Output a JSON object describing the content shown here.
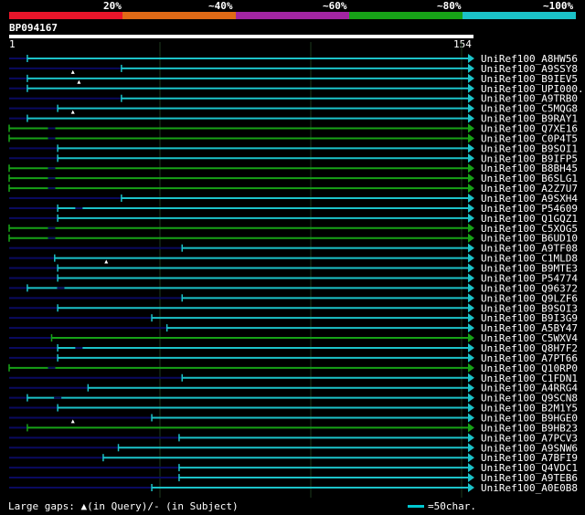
{
  "legend": {
    "labels": [
      "20%",
      "~40%",
      "~60%",
      "~80%",
      "~100%"
    ],
    "colors": [
      "#e8152a",
      "#e06a16",
      "#a225a2",
      "#17a217",
      "#1bc2c8"
    ]
  },
  "query": {
    "id": "BP094167",
    "length_start": "1",
    "length_end": "154"
  },
  "hits": [
    {
      "label": "UniRef100_A8HW56",
      "start": 7,
      "color": "cyan",
      "gaps": []
    },
    {
      "label": "UniRef100_A9SSY8",
      "start": 38,
      "color": "cyan",
      "gaps": []
    },
    {
      "label": "UniRef100_B9IEV5",
      "start": 7,
      "color": "cyan",
      "gaps": [
        {
          "type": "query",
          "pos": 22
        }
      ]
    },
    {
      "label": "UniRef100_UPI000...",
      "start": 7,
      "color": "cyan",
      "gaps": [
        {
          "type": "query",
          "pos": 24
        }
      ]
    },
    {
      "label": "UniRef100_A9TRB0",
      "start": 38,
      "color": "cyan",
      "gaps": []
    },
    {
      "label": "UniRef100_C5MQG8",
      "start": 17,
      "color": "cyan",
      "gaps": []
    },
    {
      "label": "UniRef100_B9RAY1",
      "start": 7,
      "color": "cyan",
      "gaps": [
        {
          "type": "query",
          "pos": 22
        }
      ]
    },
    {
      "label": "UniRef100_Q7XE16",
      "start": 1,
      "color": "green",
      "gaps": [
        {
          "type": "subject",
          "pos": 15
        }
      ]
    },
    {
      "label": "UniRef100_C0P4T5",
      "start": 1,
      "color": "green",
      "gaps": [
        {
          "type": "subject",
          "pos": 15
        }
      ]
    },
    {
      "label": "UniRef100_B9SOI1",
      "start": 17,
      "color": "cyan",
      "gaps": []
    },
    {
      "label": "UniRef100_B9IFP5",
      "start": 17,
      "color": "cyan",
      "gaps": []
    },
    {
      "label": "UniRef100_B8BH45",
      "start": 1,
      "color": "green",
      "gaps": [
        {
          "type": "subject",
          "pos": 15
        }
      ]
    },
    {
      "label": "UniRef100_B6SLG1",
      "start": 1,
      "color": "green",
      "gaps": [
        {
          "type": "subject",
          "pos": 15
        }
      ]
    },
    {
      "label": "UniRef100_A2Z7U7",
      "start": 1,
      "color": "green",
      "gaps": [
        {
          "type": "subject",
          "pos": 15
        }
      ]
    },
    {
      "label": "UniRef100_A9SXH4",
      "start": 38,
      "color": "cyan",
      "gaps": []
    },
    {
      "label": "UniRef100_P54609",
      "start": 17,
      "color": "cyan",
      "gaps": [
        {
          "type": "subject",
          "pos": 24
        }
      ]
    },
    {
      "label": "UniRef100_Q1GQZ1",
      "start": 17,
      "color": "cyan",
      "gaps": []
    },
    {
      "label": "UniRef100_C5XOG5",
      "start": 1,
      "color": "green",
      "gaps": [
        {
          "type": "subject",
          "pos": 15
        }
      ]
    },
    {
      "label": "UniRef100_B6UD10",
      "start": 1,
      "color": "green",
      "gaps": [
        {
          "type": "subject",
          "pos": 15
        }
      ]
    },
    {
      "label": "UniRef100_A9TF08",
      "start": 58,
      "color": "cyan",
      "gaps": []
    },
    {
      "label": "UniRef100_C1MLD8",
      "start": 16,
      "color": "cyan",
      "gaps": []
    },
    {
      "label": "UniRef100_B9MTE3",
      "start": 17,
      "color": "cyan",
      "gaps": [
        {
          "type": "query",
          "pos": 33
        }
      ]
    },
    {
      "label": "UniRef100_P54774",
      "start": 17,
      "color": "cyan",
      "gaps": []
    },
    {
      "label": "UniRef100_Q96372",
      "start": 7,
      "color": "cyan",
      "gaps": [
        {
          "type": "subject",
          "pos": 18
        }
      ]
    },
    {
      "label": "UniRef100_Q9LZF6",
      "start": 58,
      "color": "cyan",
      "gaps": []
    },
    {
      "label": "UniRef100_B9SOI3",
      "start": 17,
      "color": "cyan",
      "gaps": []
    },
    {
      "label": "UniRef100_B9I3G9",
      "start": 48,
      "color": "cyan",
      "gaps": []
    },
    {
      "label": "UniRef100_A5BY47",
      "start": 53,
      "color": "cyan",
      "gaps": []
    },
    {
      "label": "UniRef100_C5WXV4",
      "start": 15,
      "color": "green",
      "gaps": []
    },
    {
      "label": "UniRef100_Q8H7F2",
      "start": 17,
      "color": "cyan",
      "gaps": [
        {
          "type": "subject",
          "pos": 24
        }
      ]
    },
    {
      "label": "UniRef100_A7PT66",
      "start": 17,
      "color": "cyan",
      "gaps": []
    },
    {
      "label": "UniRef100_Q10RP0",
      "start": 1,
      "color": "green",
      "gaps": [
        {
          "type": "subject",
          "pos": 15
        }
      ]
    },
    {
      "label": "UniRef100_C1FDN1",
      "start": 58,
      "color": "cyan",
      "gaps": []
    },
    {
      "label": "UniRef100_A4RRG4",
      "start": 27,
      "color": "cyan",
      "gaps": []
    },
    {
      "label": "UniRef100_Q9SCN8",
      "start": 7,
      "color": "cyan",
      "gaps": [
        {
          "type": "subject",
          "pos": 17
        }
      ]
    },
    {
      "label": "UniRef100_B2M1Y5",
      "start": 17,
      "color": "cyan",
      "gaps": []
    },
    {
      "label": "UniRef100_B9HGE0",
      "start": 48,
      "color": "cyan",
      "gaps": []
    },
    {
      "label": "UniRef100_B9HB23",
      "start": 7,
      "color": "green",
      "gaps": [
        {
          "type": "query",
          "pos": 22
        }
      ]
    },
    {
      "label": "UniRef100_A7PCV3",
      "start": 57,
      "color": "cyan",
      "gaps": []
    },
    {
      "label": "UniRef100_A9SNW6",
      "start": 37,
      "color": "cyan",
      "gaps": []
    },
    {
      "label": "UniRef100_A7BFI9",
      "start": 32,
      "color": "cyan",
      "gaps": []
    },
    {
      "label": "UniRef100_Q4VDC1",
      "start": 57,
      "color": "cyan",
      "gaps": []
    },
    {
      "label": "UniRef100_A9TEB6",
      "start": 57,
      "color": "cyan",
      "gaps": []
    },
    {
      "label": "UniRef100_A0E0B8",
      "start": 48,
      "color": "cyan",
      "gaps": []
    }
  ],
  "colors": {
    "cyan": "#1bc2c8",
    "green": "#17a217",
    "navy": "#0a0a60"
  },
  "footer": {
    "gaps_text": "Large gaps: ▲(in Query)/- (in Subject)",
    "scale_text": "=50char."
  }
}
